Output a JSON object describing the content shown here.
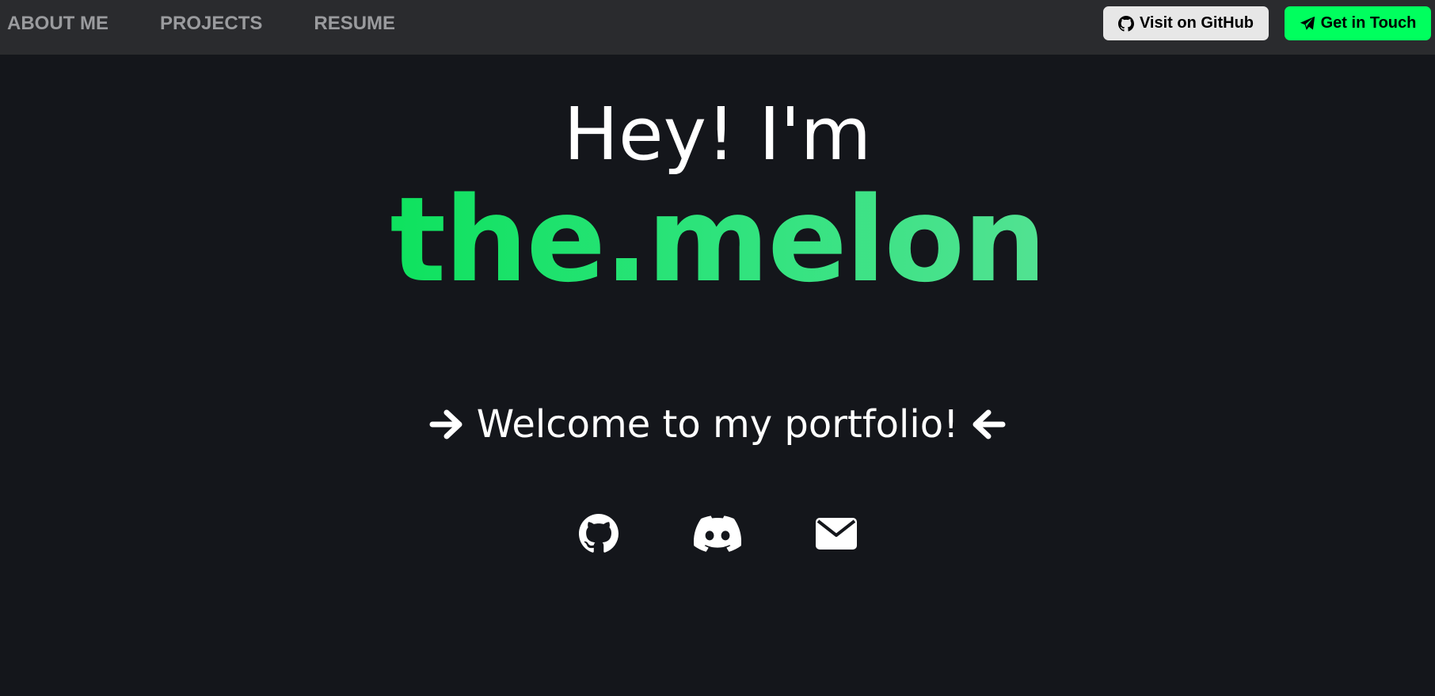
{
  "nav": {
    "items": [
      {
        "label": "ABOUT ME"
      },
      {
        "label": "PROJECTS"
      },
      {
        "label": "RESUME"
      }
    ],
    "github_button": {
      "label": "Visit on GitHub",
      "icon": "github-icon"
    },
    "contact_button": {
      "label": "Get in Touch",
      "icon": "paper-plane-icon"
    }
  },
  "hero": {
    "greeting": "Hey! I'm",
    "name": "the.melon",
    "welcome": "Welcome to my portfolio!",
    "left_icon": "arrow-right-icon",
    "right_icon": "arrow-left-icon"
  },
  "social": {
    "links": [
      {
        "icon": "github-icon"
      },
      {
        "icon": "discord-icon"
      },
      {
        "icon": "envelope-icon"
      }
    ]
  },
  "colors": {
    "background": "#14161b",
    "topbar": "#2a2b2e",
    "nav_text": "#9a9b9e",
    "accent": "#00ff5e",
    "name_gradient_start": "#0ee25e",
    "name_gradient_end": "#52e292",
    "github_button_bg": "#e7e7e7"
  }
}
